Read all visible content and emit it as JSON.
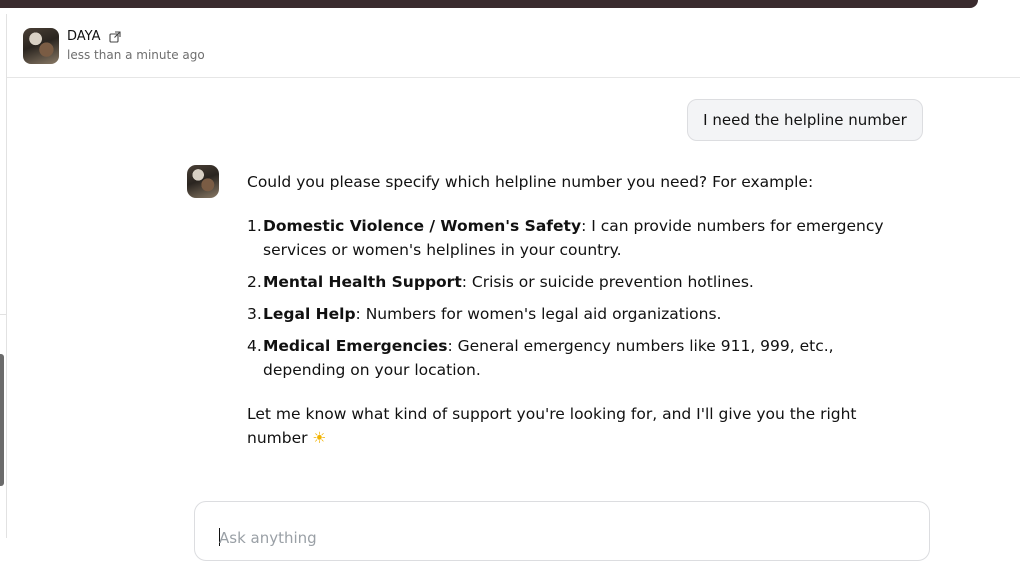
{
  "header": {
    "name": "DAYA",
    "time": "less than a minute ago",
    "icons": {
      "avatar": "daya-avatar",
      "external": "external-link-icon"
    }
  },
  "conversation": {
    "user_message": "I need the helpline number",
    "reply": {
      "intro": "Could you please specify which helpline number you need? For example:",
      "items": [
        {
          "num": "1.",
          "title": "Domestic Violence / Women's Safety",
          "text": ": I can provide numbers for emergency services or women's helplines in your country."
        },
        {
          "num": "2.",
          "title": "Mental Health Support",
          "text": ": Crisis or suicide prevention hotlines."
        },
        {
          "num": "3.",
          "title": "Legal Help",
          "text": ": Numbers for women's legal aid organizations."
        },
        {
          "num": "4.",
          "title": "Medical Emergencies",
          "text": ": General emergency numbers like 911, 999, etc., depending on your location."
        }
      ],
      "closing": "Let me know what kind of support you're looking for, and I'll give you the right number ",
      "emoji": "☀"
    }
  },
  "composer": {
    "placeholder": "Ask anything"
  },
  "colors": {
    "topbar": "#3a2b2e",
    "bubble_bg": "#f3f4f6",
    "emoji": "#f2b300"
  }
}
